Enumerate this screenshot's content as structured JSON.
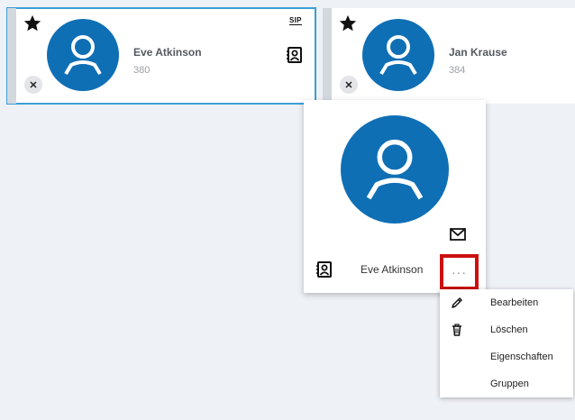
{
  "contacts": [
    {
      "name": "Eve Atkinson",
      "extension": "380",
      "badge": "SIP"
    },
    {
      "name": "Jan Krause",
      "extension": "384"
    }
  ],
  "popup": {
    "name": "Eve Atkinson",
    "more_label": "···"
  },
  "context_menu": {
    "items": [
      {
        "label": "Bearbeiten",
        "icon": "pencil-icon"
      },
      {
        "label": "Löschen",
        "icon": "trash-icon"
      },
      {
        "label": "Eigenschaften"
      },
      {
        "label": "Gruppen"
      }
    ]
  },
  "colors": {
    "avatar": "#0f6fb5",
    "selected_outline": "#3b9fd6",
    "highlight": "#cc1010"
  }
}
